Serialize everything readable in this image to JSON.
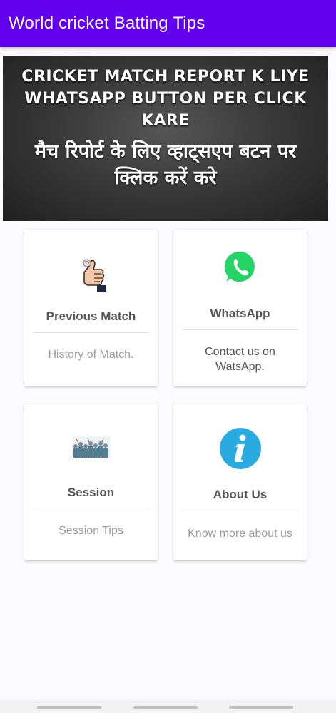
{
  "app_bar": {
    "title": "World cricket Batting Tips"
  },
  "banner": {
    "english_text": "CRICKET MATCH REPORT K LIYE WHATSAPP BUTTON PER CLICK KARE",
    "hindi_text": "मैच रिपोर्ट के लिए व्हाट्सएप बटन पर क्लिक करें करे"
  },
  "cards": {
    "previous_match": {
      "title": "Previous Match",
      "subtitle": "History of Match.",
      "icon": "thumbs-up-hand-icon"
    },
    "whatsapp": {
      "title": "WhatsApp",
      "subtitle": "Contact us on WatsApp.",
      "icon": "whatsapp-icon",
      "color": "#25d366"
    },
    "session": {
      "title": "Session",
      "subtitle": "Session Tips",
      "icon": "crowd-icon"
    },
    "about": {
      "title": "About Us",
      "subtitle": "Know more about us",
      "icon": "info-icon",
      "color": "#29abe2"
    }
  },
  "colors": {
    "app_bar": "#6200ee",
    "background": "#fbfafc"
  }
}
